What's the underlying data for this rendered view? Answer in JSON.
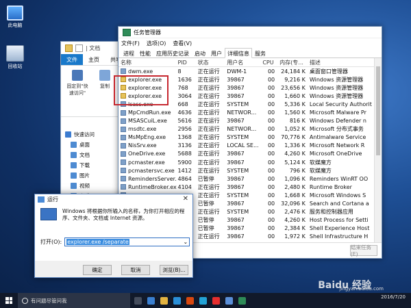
{
  "desktop": {
    "icons": [
      {
        "label": "此电脑",
        "icon": "computer-icon"
      },
      {
        "label": "回收站",
        "icon": "recycle-bin-icon"
      }
    ]
  },
  "explorer": {
    "title_fragment": "| 文档",
    "tabs": [
      "文件",
      "主页",
      "共享"
    ],
    "ribbon": [
      {
        "label": "固定到\"快速访问\"",
        "icon": "pin-icon"
      },
      {
        "label": "复制",
        "icon": "copy-icon"
      },
      {
        "label": "粘贴",
        "icon": "paste-icon"
      }
    ],
    "nav": [
      {
        "label": "快速访问",
        "icon": "star-icon"
      },
      {
        "label": "桌面",
        "icon": "desktop-icon"
      },
      {
        "label": "文档",
        "icon": "documents-icon"
      },
      {
        "label": "下载",
        "icon": "download-icon"
      },
      {
        "label": "图片",
        "icon": "pictures-icon"
      },
      {
        "label": "视频",
        "icon": "videos-icon"
      },
      {
        "label": "音乐",
        "icon": "music-icon"
      }
    ]
  },
  "task_manager": {
    "title": "任务管理器",
    "menu": [
      "文件(F)",
      "选项(O)",
      "查看(V)"
    ],
    "tabs": [
      "进程",
      "性能",
      "应用历史记录",
      "启动",
      "用户",
      "详细信息",
      "服务"
    ],
    "active_tab": "详细信息",
    "columns": {
      "name": "名称",
      "pid": "PID",
      "status": "状态",
      "user": "用户名",
      "cpu": "CPU",
      "mem": "内存(专...",
      "desc": "描述"
    },
    "rows": [
      {
        "name": "dwm.exe",
        "pid": "8",
        "status": "正在运行",
        "user": "DWM-1",
        "cpu": "00",
        "mem": "24,184 K",
        "desc": "桌面窗口管理器"
      },
      {
        "name": "explorer.exe",
        "pid": "1636",
        "status": "正在运行",
        "user": "39867",
        "cpu": "00",
        "mem": "9,216 K",
        "desc": "Windows 资源管理器"
      },
      {
        "name": "explorer.exe",
        "pid": "768",
        "status": "正在运行",
        "user": "39867",
        "cpu": "00",
        "mem": "23,656 K",
        "desc": "Windows 资源管理器"
      },
      {
        "name": "explorer.exe",
        "pid": "3064",
        "status": "正在运行",
        "user": "39867",
        "cpu": "00",
        "mem": "1,660 K",
        "desc": "Windows 资源管理器"
      },
      {
        "name": "lsass.exe",
        "pid": "668",
        "status": "正在运行",
        "user": "SYSTEM",
        "cpu": "00",
        "mem": "5,336 K",
        "desc": "Local Security Authorit"
      },
      {
        "name": "MpCmdRun.exe",
        "pid": "4636",
        "status": "正在运行",
        "user": "NETWOR...",
        "cpu": "00",
        "mem": "1,560 K",
        "desc": "Microsoft Malware Pr"
      },
      {
        "name": "MSASCuiL.exe",
        "pid": "5616",
        "status": "正在运行",
        "user": "39867",
        "cpu": "00",
        "mem": "816 K",
        "desc": "Windows Defender n"
      },
      {
        "name": "msdtc.exe",
        "pid": "2956",
        "status": "正在运行",
        "user": "NETWOR...",
        "cpu": "00",
        "mem": "1,052 K",
        "desc": "Microsoft 分布式事务"
      },
      {
        "name": "MsMpEng.exe",
        "pid": "1368",
        "status": "正在运行",
        "user": "SYSTEM",
        "cpu": "00",
        "mem": "70,776 K",
        "desc": "Antimalware Service"
      },
      {
        "name": "NisSrv.exe",
        "pid": "3136",
        "status": "正在运行",
        "user": "LOCAL SE...",
        "cpu": "00",
        "mem": "1,336 K",
        "desc": "Microsoft Network R"
      },
      {
        "name": "OneDrive.exe",
        "pid": "5688",
        "status": "正在运行",
        "user": "39867",
        "cpu": "00",
        "mem": "4,260 K",
        "desc": "Microsoft OneDrive"
      },
      {
        "name": "pcmaster.exe",
        "pid": "5900",
        "status": "正在运行",
        "user": "39867",
        "cpu": "00",
        "mem": "5,124 K",
        "desc": "软媒魔方"
      },
      {
        "name": "pcmastersvc.exe",
        "pid": "1412",
        "status": "正在运行",
        "user": "SYSTEM",
        "cpu": "00",
        "mem": "796 K",
        "desc": "软媒魔方"
      },
      {
        "name": "RemindersServer.e...",
        "pid": "4864",
        "status": "已暂停",
        "user": "39867",
        "cpu": "00",
        "mem": "1,096 K",
        "desc": "Reminders WinRT OO"
      },
      {
        "name": "RuntimeBroker.exe",
        "pid": "4104",
        "status": "正在运行",
        "user": "39867",
        "cpu": "00",
        "mem": "2,480 K",
        "desc": "Runtime Broker"
      },
      {
        "name": "",
        "pid": "",
        "status": "正在运行",
        "user": "SYSTEM",
        "cpu": "00",
        "mem": "1,668 K",
        "desc": "Microsoft Windows S"
      },
      {
        "name": "",
        "pid": "",
        "status": "已暂停",
        "user": "39867",
        "cpu": "00",
        "mem": "32,096 K",
        "desc": "Search and Cortana a"
      },
      {
        "name": "",
        "pid": "",
        "status": "正在运行",
        "user": "SYSTEM",
        "cpu": "00",
        "mem": "2,476 K",
        "desc": "服务和控制器应用"
      },
      {
        "name": "",
        "pid": "",
        "status": "已暂停",
        "user": "39867",
        "cpu": "00",
        "mem": "4,260 K",
        "desc": "Host Process for Setti"
      },
      {
        "name": "",
        "pid": "",
        "status": "已暂停",
        "user": "39867",
        "cpu": "00",
        "mem": "2,384 K",
        "desc": "Shell Experience Host"
      },
      {
        "name": "",
        "pid": "",
        "status": "正在运行",
        "user": "39867",
        "cpu": "00",
        "mem": "1,972 K",
        "desc": "Shell Infrastructure H"
      }
    ],
    "end_task": "结束任务(E)"
  },
  "run_dialog": {
    "title": "运行",
    "description": "Windows 将根据你所输入的名称，为你打开相应的程序、文件夹、文档或 Internet 资源。",
    "open_label": "打开(O):",
    "value": "explorer.exe /separate",
    "ok": "确定",
    "cancel": "取消",
    "browse": "浏览(B)..."
  },
  "taskbar": {
    "search_placeholder": "有问题尽管问我",
    "date": "2016/7/20",
    "watermark": "Baidu 经验",
    "watermark_url": "jingyan.baidu.com"
  }
}
